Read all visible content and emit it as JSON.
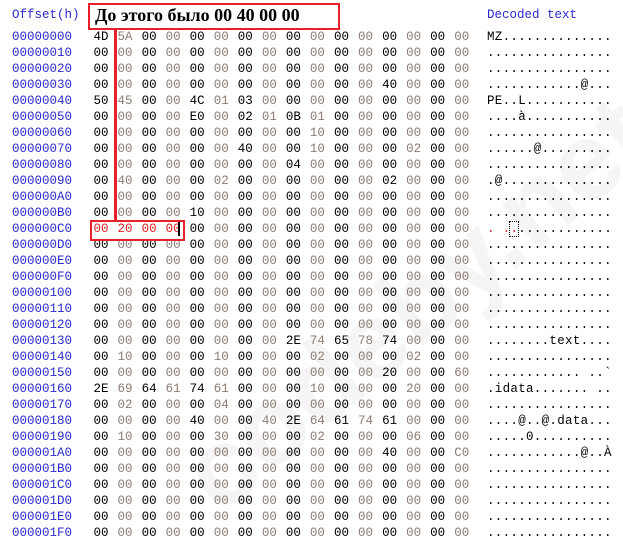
{
  "header": {
    "offset_label": "Offset(h)",
    "decoded_label": "Decoded text"
  },
  "annotation": {
    "text": "До этого было 00 40 00 00",
    "color": "#e8202a"
  },
  "watermark": "codeby.net",
  "colors": {
    "offset": "#2a2ad0",
    "even_byte": "#000000",
    "odd_byte": "#8c7b73",
    "highlight": "#e02020"
  },
  "highlight": {
    "row_offset": "000000C0",
    "bytes": "00 20 00 00"
  },
  "rows": [
    {
      "offset": "00000000",
      "bytes": "4D 5A 00 00 00 00 00 00 00 00 00 00 00 00 00 00",
      "text": "MZ.............."
    },
    {
      "offset": "00000010",
      "bytes": "00 00 00 00 00 00 00 00 00 00 00 00 00 00 00 00",
      "text": "................"
    },
    {
      "offset": "00000020",
      "bytes": "00 00 00 00 00 00 00 00 00 00 00 00 00 00 00 00",
      "text": "................"
    },
    {
      "offset": "00000030",
      "bytes": "00 00 00 00 00 00 00 00 00 00 00 00 40 00 00 00",
      "text": "............@..."
    },
    {
      "offset": "00000040",
      "bytes": "50 45 00 00 4C 01 03 00 00 00 00 00 00 00 00 00",
      "text": "PE..L..........."
    },
    {
      "offset": "00000050",
      "bytes": "00 00 00 00 E0 00 02 01 0B 01 00 00 00 00 00 00",
      "text": "....à..........."
    },
    {
      "offset": "00000060",
      "bytes": "00 00 00 00 00 00 00 00 00 10 00 00 00 00 00 00",
      "text": "................"
    },
    {
      "offset": "00000070",
      "bytes": "00 00 00 00 00 00 40 00 00 10 00 00 00 02 00 00",
      "text": "......@........."
    },
    {
      "offset": "00000080",
      "bytes": "00 00 00 00 00 00 00 00 04 00 00 00 00 00 00 00",
      "text": "................"
    },
    {
      "offset": "00000090",
      "bytes": "00 40 00 00 00 02 00 00 00 00 00 00 02 00 00 00",
      "text": ".@.............."
    },
    {
      "offset": "000000A0",
      "bytes": "00 00 00 00 00 00 00 00 00 00 00 00 00 00 00 00",
      "text": "................"
    },
    {
      "offset": "000000B0",
      "bytes": "00 00 00 00 10 00 00 00 00 00 00 00 00 00 00 00",
      "text": "................"
    },
    {
      "offset": "000000C0",
      "bytes": "00 20 00 00 00 00 00 00 00 00 00 00 00 00 00 00",
      "text": ". .............."
    },
    {
      "offset": "000000D0",
      "bytes": "00 00 00 00 00 00 00 00 00 00 00 00 00 00 00 00",
      "text": "................"
    },
    {
      "offset": "000000E0",
      "bytes": "00 00 00 00 00 00 00 00 00 00 00 00 00 00 00 00",
      "text": "................"
    },
    {
      "offset": "000000F0",
      "bytes": "00 00 00 00 00 00 00 00 00 00 00 00 00 00 00 00",
      "text": "................"
    },
    {
      "offset": "00000100",
      "bytes": "00 00 00 00 00 00 00 00 00 00 00 00 00 00 00 00",
      "text": "................"
    },
    {
      "offset": "00000110",
      "bytes": "00 00 00 00 00 00 00 00 00 00 00 00 00 00 00 00",
      "text": "................"
    },
    {
      "offset": "00000120",
      "bytes": "00 00 00 00 00 00 00 00 00 00 00 00 00 00 00 00",
      "text": "................"
    },
    {
      "offset": "00000130",
      "bytes": "00 00 00 00 00 00 00 00 2E 74 65 78 74 00 00 00",
      "text": "........text...."
    },
    {
      "offset": "00000140",
      "bytes": "00 10 00 00 00 10 00 00 00 02 00 00 00 02 00 00",
      "text": "................"
    },
    {
      "offset": "00000150",
      "bytes": "00 00 00 00 00 00 00 00 00 00 00 00 20 00 00 60",
      "text": "............ ..`"
    },
    {
      "offset": "00000160",
      "bytes": "2E 69 64 61 74 61 00 00 00 10 00 00 00 20 00 00",
      "text": ".idata....... .."
    },
    {
      "offset": "00000170",
      "bytes": "00 02 00 00 00 04 00 00 00 00 00 00 00 00 00 00",
      "text": "................"
    },
    {
      "offset": "00000180",
      "bytes": "00 00 00 00 40 00 00 40 2E 64 61 74 61 00 00 00",
      "text": "....@..@.data..."
    },
    {
      "offset": "00000190",
      "bytes": "00 10 00 00 00 30 00 00 00 02 00 00 00 06 00 00",
      "text": ".....0.........."
    },
    {
      "offset": "000001A0",
      "bytes": "00 00 00 00 00 00 00 00 00 00 00 00 40 00 00 C0",
      "text": "............@..À"
    },
    {
      "offset": "000001B0",
      "bytes": "00 00 00 00 00 00 00 00 00 00 00 00 00 00 00 00",
      "text": "................"
    },
    {
      "offset": "000001C0",
      "bytes": "00 00 00 00 00 00 00 00 00 00 00 00 00 00 00 00",
      "text": "................"
    },
    {
      "offset": "000001D0",
      "bytes": "00 00 00 00 00 00 00 00 00 00 00 00 00 00 00 00",
      "text": "................"
    },
    {
      "offset": "000001E0",
      "bytes": "00 00 00 00 00 00 00 00 00 00 00 00 00 00 00 00",
      "text": "................"
    },
    {
      "offset": "000001F0",
      "bytes": "00 00 00 00 00 00 00 00 00 00 00 00 00 00 00 00",
      "text": "................"
    }
  ]
}
